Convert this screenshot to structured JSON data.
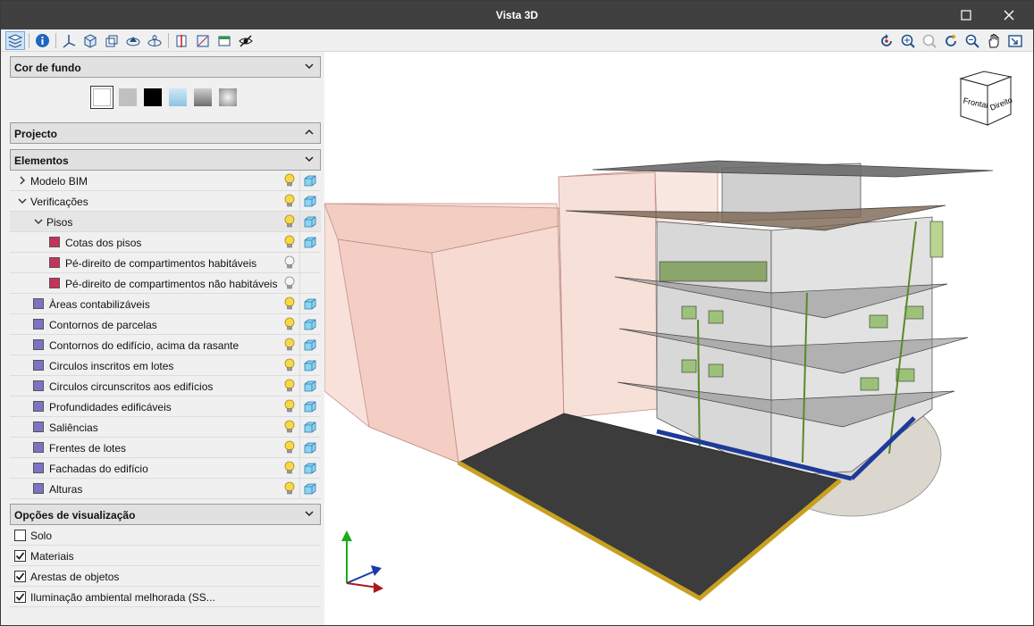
{
  "window": {
    "title": "Vista 3D"
  },
  "sections": {
    "background": "Cor de fundo",
    "project": "Projecto",
    "elements": "Elementos",
    "view_options": "Opções de visualização"
  },
  "background_colors": [
    "#ffffff",
    "#c0c0c0",
    "#000000",
    "#a8d4ec",
    "#9a9a9a",
    "#b0b0b0"
  ],
  "tree": [
    {
      "label": "Modelo BIM",
      "level": 0,
      "expander": "collapsed",
      "color": null,
      "bulb": "on",
      "cube": true
    },
    {
      "label": "Verificações",
      "level": 0,
      "expander": "expanded",
      "color": null,
      "bulb": "on",
      "cube": true
    },
    {
      "label": "Pisos",
      "level": 1,
      "expander": "expanded",
      "color": null,
      "bulb": "on",
      "cube": true
    },
    {
      "label": "Cotas dos pisos",
      "level": 2,
      "expander": null,
      "color": "#c8325a",
      "bulb": "on",
      "cube": true
    },
    {
      "label": "Pé-direito de compartimentos habitáveis",
      "level": 2,
      "expander": null,
      "color": "#c8325a",
      "bulb": "off",
      "cube": false
    },
    {
      "label": "Pé-direito de compartimentos não habitáveis",
      "level": 2,
      "expander": null,
      "color": "#c8325a",
      "bulb": "off",
      "cube": false
    },
    {
      "label": "Àreas contabilizáveis",
      "level": 1,
      "expander": null,
      "color": "#7b74c4",
      "bulb": "on",
      "cube": true
    },
    {
      "label": "Contornos de parcelas",
      "level": 1,
      "expander": null,
      "color": "#7b74c4",
      "bulb": "on",
      "cube": true
    },
    {
      "label": "Contornos do edifício, acima da rasante",
      "level": 1,
      "expander": null,
      "color": "#7b74c4",
      "bulb": "on",
      "cube": true
    },
    {
      "label": "Circulos inscritos em lotes",
      "level": 1,
      "expander": null,
      "color": "#7b74c4",
      "bulb": "on",
      "cube": true
    },
    {
      "label": "Circulos circunscritos aos edifícios",
      "level": 1,
      "expander": null,
      "color": "#7b74c4",
      "bulb": "on",
      "cube": true
    },
    {
      "label": "Profundidades edificáveis",
      "level": 1,
      "expander": null,
      "color": "#7b74c4",
      "bulb": "on",
      "cube": true
    },
    {
      "label": "Saliências",
      "level": 1,
      "expander": null,
      "color": "#7b74c4",
      "bulb": "on",
      "cube": true
    },
    {
      "label": "Frentes de lotes",
      "level": 1,
      "expander": null,
      "color": "#7b74c4",
      "bulb": "on",
      "cube": true
    },
    {
      "label": "Fachadas do edifício",
      "level": 1,
      "expander": null,
      "color": "#7b74c4",
      "bulb": "on",
      "cube": true
    },
    {
      "label": "Alturas",
      "level": 1,
      "expander": null,
      "color": "#7b74c4",
      "bulb": "on",
      "cube": true
    }
  ],
  "view_options": [
    {
      "label": "Solo",
      "checked": false
    },
    {
      "label": "Materiais",
      "checked": true
    },
    {
      "label": "Arestas de objetos",
      "checked": true
    },
    {
      "label": "Iluminação ambiental melhorada (SS...",
      "checked": true
    }
  ],
  "viewcube": {
    "front": "Frontal",
    "right": "Direito"
  },
  "icons": {
    "toolbar_left": [
      "layers-icon",
      "info-icon",
      "axes-icon",
      "iso-view-icon",
      "box-view-icon",
      "orbit-view-icon",
      "rotate-view-icon",
      "section-icon",
      "clip-box-icon",
      "floor-plan-icon",
      "hide-icon"
    ],
    "toolbar_right": [
      "rotate-icon",
      "zoom-extents-icon",
      "zoom-icon",
      "refresh-view-icon",
      "zoom-window-icon",
      "pan-icon",
      "fit-window-icon"
    ]
  }
}
